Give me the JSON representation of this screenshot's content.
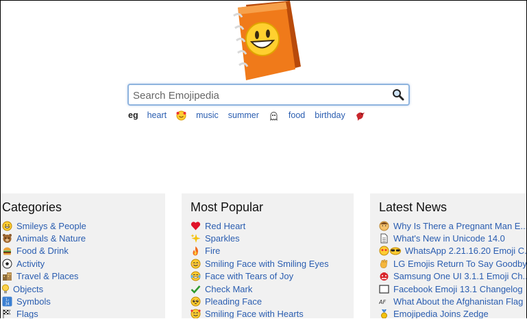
{
  "search": {
    "placeholder": "Search Emojipedia"
  },
  "suggestions": {
    "prefix": "eg",
    "items": [
      {
        "kind": "text",
        "label": "heart"
      },
      {
        "kind": "emoji",
        "icon": "smiling-face-with-hearts-icon"
      },
      {
        "kind": "text",
        "label": "music"
      },
      {
        "kind": "text",
        "label": "summer"
      },
      {
        "kind": "emoji",
        "icon": "ghost-icon"
      },
      {
        "kind": "text",
        "label": "food"
      },
      {
        "kind": "text",
        "label": "birthday"
      },
      {
        "kind": "emoji",
        "icon": "bird-icon"
      }
    ]
  },
  "categories": {
    "title": "Categories",
    "items": [
      {
        "label": "Smileys & People",
        "icon": "grinning-face-icon"
      },
      {
        "label": "Animals & Nature",
        "icon": "bear-icon"
      },
      {
        "label": "Food & Drink",
        "icon": "hamburger-icon"
      },
      {
        "label": "Activity",
        "icon": "soccer-ball-icon"
      },
      {
        "label": "Travel & Places",
        "icon": "buildings-icon"
      },
      {
        "label": "Objects",
        "icon": "light-bulb-icon"
      },
      {
        "label": "Symbols",
        "icon": "input-symbols-icon"
      },
      {
        "label": "Flags",
        "icon": "flag-icon"
      }
    ]
  },
  "popular": {
    "title": "Most Popular",
    "items": [
      {
        "label": "Red Heart",
        "icon": "red-heart-icon"
      },
      {
        "label": "Sparkles",
        "icon": "sparkles-icon"
      },
      {
        "label": "Fire",
        "icon": "fire-icon"
      },
      {
        "label": "Smiling Face with Smiling Eyes",
        "icon": "smiling-eyes-icon"
      },
      {
        "label": "Face with Tears of Joy",
        "icon": "tears-of-joy-icon"
      },
      {
        "label": "Check Mark",
        "icon": "check-mark-icon"
      },
      {
        "label": "Pleading Face",
        "icon": "pleading-face-icon"
      },
      {
        "label": "Smiling Face with Hearts",
        "icon": "smiling-face-with-hearts-icon"
      }
    ]
  },
  "news": {
    "title": "Latest News",
    "items": [
      {
        "label": "Why Is There a Pregnant Man E...",
        "icon": "pregnant-man-icon"
      },
      {
        "label": "What's New in Unicode 14.0",
        "icon": "page-icon"
      },
      {
        "label": "WhatsApp 2.21.16.20 Emoji C...",
        "icon": "whatsapp-faces-icon"
      },
      {
        "label": "LG Emojis Return To Say Goodbye",
        "icon": "waving-hand-icon"
      },
      {
        "label": "Samsung One UI 3.1.1 Emoji Ch...",
        "icon": "ogre-icon"
      },
      {
        "label": "Facebook Emoji 13.1 Changelog",
        "icon": "square-icon"
      },
      {
        "label": "What About the Afghanistan Flag ...",
        "icon": "af-flag-icon"
      },
      {
        "label": "Emojipedia Joins Zedge",
        "icon": "medal-icon"
      }
    ]
  }
}
